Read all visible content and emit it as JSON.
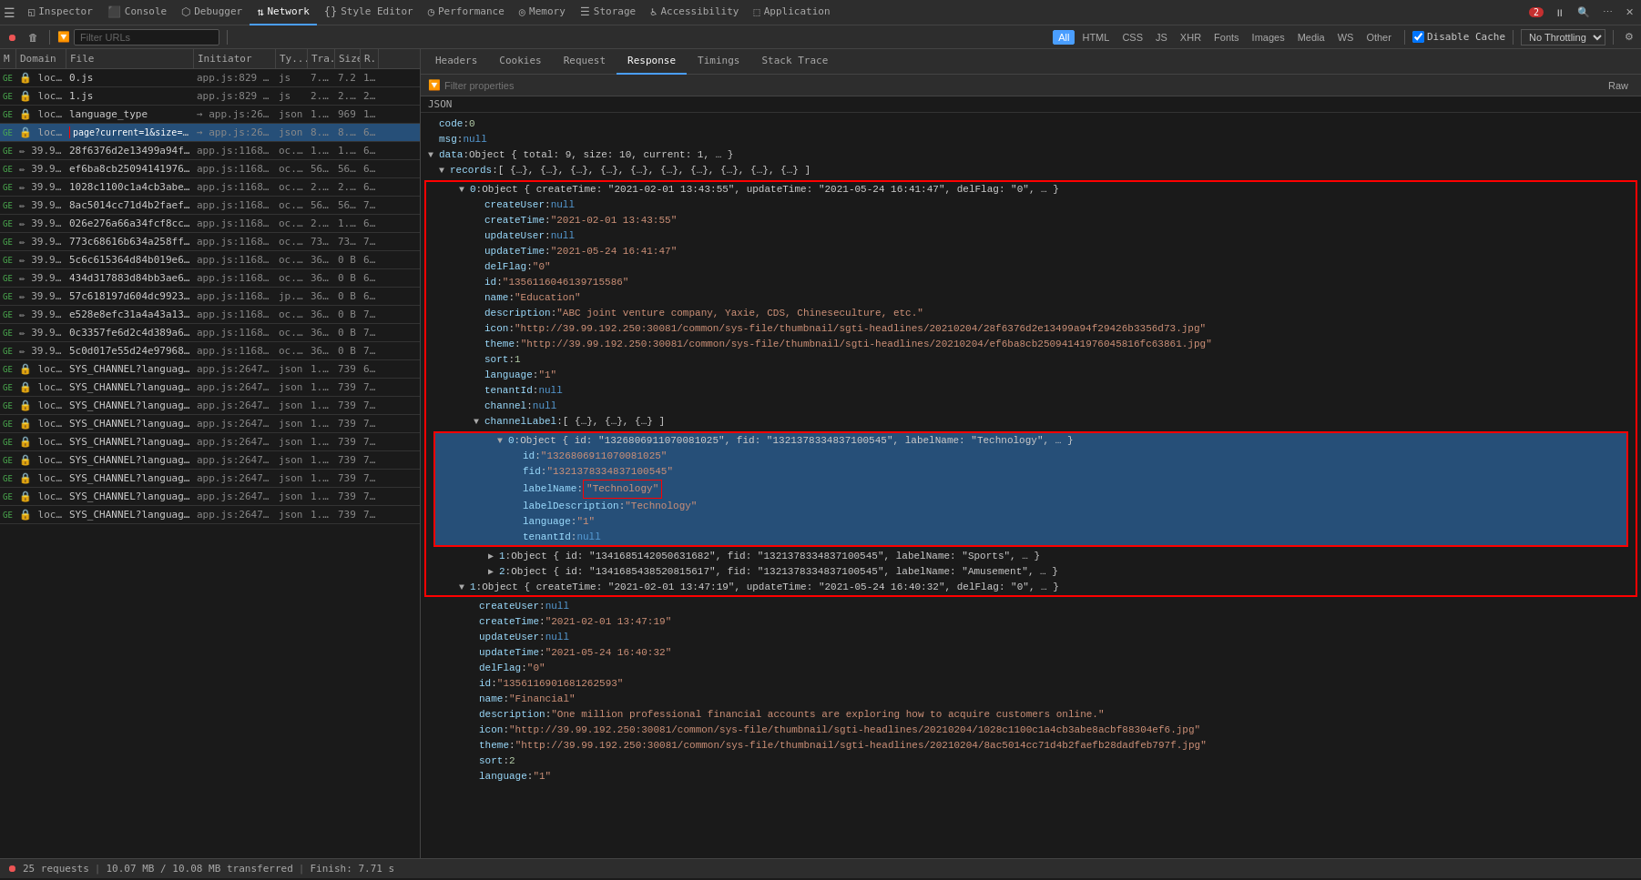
{
  "devtools": {
    "tabs": [
      {
        "label": "Inspector",
        "icon": "◱",
        "active": false
      },
      {
        "label": "Console",
        "icon": "⬛",
        "active": false
      },
      {
        "label": "Debugger",
        "icon": "⬡",
        "active": false
      },
      {
        "label": "Network",
        "icon": "⇅",
        "active": true
      },
      {
        "label": "Style Editor",
        "icon": "{}",
        "active": false
      },
      {
        "label": "Performance",
        "icon": "◷",
        "active": false
      },
      {
        "label": "Memory",
        "icon": "◎",
        "active": false
      },
      {
        "label": "Storage",
        "icon": "☰",
        "active": false
      },
      {
        "label": "Accessibility",
        "icon": "♿",
        "active": false
      },
      {
        "label": "Application",
        "icon": "⬚",
        "active": false
      }
    ],
    "error_count": "2",
    "toolbar_right_icons": [
      "pause",
      "search",
      "stop"
    ]
  },
  "network": {
    "filter_placeholder": "Filter URLs",
    "controls": {
      "pause_label": "⏸",
      "clear_label": "🗑",
      "search_label": "🔍",
      "camera_label": "📷"
    },
    "filter_types": [
      "All",
      "HTML",
      "CSS",
      "JS",
      "XHR",
      "Fonts",
      "Images",
      "Media",
      "WS",
      "Other"
    ],
    "active_filter": "All",
    "disable_cache": true,
    "disable_cache_label": "Disable Cache",
    "throttle_label": "No Throttling ▾",
    "gear_label": "⚙"
  },
  "columns": {
    "headers": [
      "M",
      "Domain",
      "File",
      "Initiator",
      "Ty...",
      "Tra...",
      "Size",
      "R..."
    ]
  },
  "requests": [
    {
      "method": "GE",
      "domain": "🔒 loca...",
      "file": "0.js",
      "initiator": "app.js:829 (…",
      "type": "js",
      "trans": "7.2...",
      "size": "7.2",
      "r": "1..."
    },
    {
      "method": "GE",
      "domain": "🔒 loca...",
      "file": "1.js",
      "initiator": "app.js:829 (…",
      "type": "js",
      "trans": "2.6...",
      "size": "2.6(",
      "r": "2..."
    },
    {
      "method": "GE",
      "domain": "🔒 loca...",
      "file": "language_type",
      "initiator": "→ app.js:2647...",
      "type": "json",
      "trans": "1.3...",
      "size": "969",
      "r": "1..."
    },
    {
      "method": "GE",
      "domain": "🔒 loca...",
      "file": "page?current=1&size=10",
      "initiator": "→ app.js:2647...",
      "type": "json",
      "trans": "8.9...",
      "size": "8.4(",
      "r": "6...",
      "selected": true,
      "red_outline": true
    },
    {
      "method": "GE",
      "domain": "✏ 39.9...",
      "file": "28f6376d2e13499a94f29426b3356d73.jpg",
      "initiator": "app.js:1168...",
      "type": "oc...",
      "trans": "1.7...",
      "size": "1.3(",
      "r": "6..."
    },
    {
      "method": "GE",
      "domain": "✏ 39.9...",
      "file": "ef6ba8cb25094141976045816fc63861.jpg",
      "initiator": "app.js:1168...",
      "type": "oc...",
      "trans": "56...",
      "size": "56.(",
      "r": "6..."
    },
    {
      "method": "GE",
      "domain": "✏ 39.9...",
      "file": "1028c1100c1a4cb3abe8acbf88304ef6.jpg",
      "initiator": "app.js:1168...",
      "type": "oc...",
      "trans": "2.7...",
      "size": "2.3(",
      "r": "6..."
    },
    {
      "method": "GE",
      "domain": "✏ 39.9...",
      "file": "8ac5014cc71d4b2faefb28dadfeb797f.jpg",
      "initiator": "app.js:1168...",
      "type": "oc...",
      "trans": "56...",
      "size": "56.(",
      "r": "7..."
    },
    {
      "method": "GE",
      "domain": "✏ 39.9...",
      "file": "026e276a66a34fcf8cc3c825e2dee606.jpg",
      "initiator": "app.js:1168...",
      "type": "oc...",
      "trans": "2.3...",
      "size": "1.8(",
      "r": "6..."
    },
    {
      "method": "GE",
      "domain": "✏ 39.9...",
      "file": "773c68616b634a258ffaaf4701aafb40.jpg",
      "initiator": "app.js:1168...",
      "type": "oc...",
      "trans": "73...",
      "size": "73.(",
      "r": "7..."
    },
    {
      "method": "GE",
      "domain": "✏ 39.9...",
      "file": "5c6c615364d84b019e6648c6cc7cd60a.jpg",
      "initiator": "app.js:1168...",
      "type": "oc...",
      "trans": "36...",
      "size": "0 B",
      "r": "6..."
    },
    {
      "method": "GE",
      "domain": "✏ 39.9...",
      "file": "434d317883d84bb3ae65ef3117104a50.jpg",
      "initiator": "app.js:1168...",
      "type": "oc...",
      "trans": "36...",
      "size": "0 B",
      "r": "6..."
    },
    {
      "method": "GE",
      "domain": "✏ 39.9...",
      "file": "57c618197d604dc99232ed3fd0d09237.jpg",
      "initiator": "app.js:1168...",
      "type": "jp...",
      "trans": "36...",
      "size": "0 B",
      "r": "6..."
    },
    {
      "method": "GE",
      "domain": "✏ 39.9...",
      "file": "e528e8efc31a4a43a13c53cac23e645e.jpg",
      "initiator": "app.js:1168...",
      "type": "oc...",
      "trans": "36...",
      "size": "0 B",
      "r": "7 s"
    },
    {
      "method": "GE",
      "domain": "✏ 39.9...",
      "file": "0c3357fe6d2c4d389a61a7ac36e72da4.jpg",
      "initiator": "app.js:1168...",
      "type": "oc...",
      "trans": "36...",
      "size": "0 B",
      "r": "7..."
    },
    {
      "method": "GE",
      "domain": "✏ 39.9...",
      "file": "5c0d017e55d24e97968a9437a651921a.jpg",
      "initiator": "app.js:1168...",
      "type": "oc...",
      "trans": "36...",
      "size": "0 B",
      "r": "7..."
    },
    {
      "method": "GE",
      "domain": "🔒 loca...",
      "file": "SYS_CHANNEL?language=",
      "initiator": "app.js:2647...",
      "type": "json",
      "trans": "1.1...",
      "size": "739",
      "r": "6..."
    },
    {
      "method": "GE",
      "domain": "🔒 loca...",
      "file": "SYS_CHANNEL?language=",
      "initiator": "app.js:2647...",
      "type": "json",
      "trans": "1.1...",
      "size": "739",
      "r": "7..."
    },
    {
      "method": "GE",
      "domain": "🔒 loca...",
      "file": "SYS_CHANNEL?language=",
      "initiator": "app.js:2647...",
      "type": "json",
      "trans": "1.1...",
      "size": "739",
      "r": "7..."
    },
    {
      "method": "GE",
      "domain": "🔒 loca...",
      "file": "SYS_CHANNEL?language=",
      "initiator": "app.js:2647...",
      "type": "json",
      "trans": "1.1...",
      "size": "739",
      "r": "7..."
    },
    {
      "method": "GE",
      "domain": "🔒 loca...",
      "file": "SYS_CHANNEL?language=",
      "initiator": "app.js:2647...",
      "type": "json",
      "trans": "1.1...",
      "size": "739",
      "r": "7..."
    },
    {
      "method": "GE",
      "domain": "🔒 loca...",
      "file": "SYS_CHANNEL?language=",
      "initiator": "app.js:2647...",
      "type": "json",
      "trans": "1.1...",
      "size": "739",
      "r": "7..."
    },
    {
      "method": "GE",
      "domain": "🔒 loca...",
      "file": "SYS_CHANNEL?language=",
      "initiator": "app.js:2647...",
      "type": "json",
      "trans": "1.1...",
      "size": "739",
      "r": "7..."
    },
    {
      "method": "GE",
      "domain": "🔒 loca...",
      "file": "SYS_CHANNEL?language=",
      "initiator": "app.js:2647...",
      "type": "json",
      "trans": "1.1...",
      "size": "739",
      "r": "7..."
    },
    {
      "method": "GE",
      "domain": "🔒 loca...",
      "file": "SYS_CHANNEL?language=",
      "initiator": "app.js:2647...",
      "type": "json",
      "trans": "1.1...",
      "size": "739",
      "r": "7..."
    }
  ],
  "detail_tabs": [
    {
      "label": "Headers",
      "active": false
    },
    {
      "label": "Cookies",
      "active": false
    },
    {
      "label": "Request",
      "active": false
    },
    {
      "label": "Response",
      "active": true
    },
    {
      "label": "Timings",
      "active": false
    },
    {
      "label": "Stack Trace",
      "active": false
    }
  ],
  "response": {
    "filter_placeholder": "Filter properties",
    "raw_label": "Raw",
    "json_label": "JSON",
    "lines": [
      {
        "indent": 0,
        "content": "code: 0",
        "type": "keyval",
        "key": "code",
        "val": "0",
        "val_type": "num"
      },
      {
        "indent": 0,
        "content": "msg: null",
        "type": "keyval",
        "key": "msg",
        "val": "null",
        "val_type": "null"
      },
      {
        "indent": 0,
        "content": "▼ data: Object { total: 9, size: 10, current: 1, … }",
        "type": "object_open",
        "key": "data",
        "summary": "Object { total: 9, size: 10, current: 1, … }",
        "expanded": true
      },
      {
        "indent": 1,
        "content": "▼ records: [ {…}, {…}, {…}, {…}, {…}, {…}, {…}, {…}, {…}, {…} ]",
        "type": "array_open",
        "key": "records",
        "summary": "[ {…}, {…}, {…}, {…}, {…}, {…}, {…}, {…}, {…}, {…} ]",
        "expanded": true
      },
      {
        "indent": 2,
        "content": "▼ 0: Object { createTime: \"2021-02-01 13:43:55\", updateTime: \"2021-05-24 16:41:47\", delFlag: \"0\", … }",
        "type": "object_open",
        "key": "0",
        "summary": "Object { createTime: \"2021-02-01 13:43:55\", updateTime: \"2021-05-24 16:41:47\", delFlag: \"0\", … }",
        "expanded": true,
        "red_box": true
      },
      {
        "indent": 3,
        "content": "createUser: null",
        "key": "createUser",
        "val": "null",
        "val_type": "null"
      },
      {
        "indent": 3,
        "content": "createTime: \"2021-02-01 13:43:55\"",
        "key": "createTime",
        "val": "\"2021-02-01 13:43:55\"",
        "val_type": "str"
      },
      {
        "indent": 3,
        "content": "updateUser: null",
        "key": "updateUser",
        "val": "null",
        "val_type": "null"
      },
      {
        "indent": 3,
        "content": "updateTime: \"2021-05-24 16:41:47\"",
        "key": "updateTime",
        "val": "\"2021-05-24 16:41:47\"",
        "val_type": "str"
      },
      {
        "indent": 3,
        "content": "delFlag: \"0\"",
        "key": "delFlag",
        "val": "\"0\"",
        "val_type": "str"
      },
      {
        "indent": 3,
        "content": "id: \"135611604613971558­6\"",
        "key": "id",
        "val": "\"135611604613971558­6\"",
        "val_type": "str"
      },
      {
        "indent": 3,
        "content": "name: \"Education\"",
        "key": "name",
        "val": "\"Education\"",
        "val_type": "str"
      },
      {
        "indent": 3,
        "content": "description: \"ABC joint venture company, Yaxie, CDS, Chineseculture, etc.\"",
        "key": "description",
        "val": "\"ABC joint venture company, Yaxie, CDS, Chineseculture, etc.\"",
        "val_type": "str"
      },
      {
        "indent": 3,
        "content": "icon: \"http://39.99.192.250:30081/common/sys-file/thumbnail/sgti-headlines/20210204/28f6376d2e13499a94f29426b3356d73.jpg\"",
        "key": "icon",
        "val": "\"http://39.99.192.250:30081/common/sys-file/thumbnail/sgti-headlines/20210204/28f6376d2e13499a94f29426b3356d73.jpg\"",
        "val_type": "str"
      },
      {
        "indent": 3,
        "content": "theme: \"http://39.99.192.250:30081/common/sys-file/thumbnail/sgti-headlines/20210204/ef6ba8cb25094141976045816fc63861.jpg\"",
        "key": "theme",
        "val": "\"http://39.99.192.250:30081/common/sys-file/thumbnail/sgti-headlines/20210204/ef6ba8cb25094141976045816fc63861.jpg\"",
        "val_type": "str"
      },
      {
        "indent": 3,
        "content": "sort: 1",
        "key": "sort",
        "val": "1",
        "val_type": "num"
      },
      {
        "indent": 3,
        "content": "language: \"1\"",
        "key": "language",
        "val": "\"1\"",
        "val_type": "str"
      },
      {
        "indent": 3,
        "content": "tenantId: null",
        "key": "tenantId",
        "val": "null",
        "val_type": "null"
      },
      {
        "indent": 3,
        "content": "channel: null",
        "key": "channel",
        "val": "null",
        "val_type": "null"
      },
      {
        "indent": 3,
        "content": "▼ channelLabel: [ {…}, {…}, {…} ]",
        "type": "array_open",
        "key": "channelLabel",
        "summary": "[ {…}, {…}, {…} ]",
        "expanded": true
      },
      {
        "indent": 4,
        "content": "▼ 0: Object { id: \"13268069110700810­25\", fid: \"13213783348371005­45\", labelName: \"Technology\", … }",
        "type": "object_open",
        "key": "0",
        "summary": "Object { id: \"13268069110700810­25\", fid: \"13213783348371005­45\", labelName: \"Technology\", … }",
        "expanded": true,
        "selected": true
      },
      {
        "indent": 5,
        "content": "id: \"1326806911070081025\"",
        "key": "id",
        "val": "\"1326806911070081025\"",
        "val_type": "str"
      },
      {
        "indent": 5,
        "content": "fid: \"1321378334837100545\"",
        "key": "fid",
        "val": "\"1321378334837100545\"",
        "val_type": "str"
      },
      {
        "indent": 5,
        "content": "labelName: \"Technology\"",
        "key": "labelName",
        "val": "\"Technology\"",
        "val_type": "str",
        "red_box_inline": true
      },
      {
        "indent": 5,
        "content": "labelDescription: \"Technology\"",
        "key": "labelDescription",
        "val": "\"Technology\"",
        "val_type": "str"
      },
      {
        "indent": 5,
        "content": "language: \"1\"",
        "key": "language",
        "val": "\"1\"",
        "val_type": "str"
      },
      {
        "indent": 5,
        "content": "tenantId: null",
        "key": "tenantId",
        "val": "null",
        "val_type": "null"
      },
      {
        "indent": 4,
        "content": "▶ 1: Object { id: \"1341685142050631682\", fid: \"1321378334837100545\", labelName: \"Sports\", … }",
        "type": "object_closed",
        "key": "1",
        "summary": "Object { id: \"1341685142050631682\", fid: \"1321378334837100545\", labelName: \"Sports\", … }"
      },
      {
        "indent": 4,
        "content": "▶ 2: Object { id: \"1341685438520815617\", fid: \"1321378334837100545\", labelName: \"Amusement\", … }",
        "type": "object_closed",
        "key": "2",
        "summary": "Object { id: \"1341685438520815617\", fid: \"1321378334837100545\", labelName: \"Amusement\", … }"
      },
      {
        "indent": 2,
        "content": "▼ 1: Object { createTime: \"2021-02-01 13:47:19\", updateTime: \"2021-05-24 16:40:32\", delFlag: \"0\", … }",
        "type": "object_open",
        "key": "1",
        "summary": "Object { createTime: \"2021-02-01 13:47:19\", updateTime: \"2021-05-24 16:40:32\", delFlag: \"0\", … }",
        "expanded": true
      },
      {
        "indent": 3,
        "content": "createUser: null",
        "key": "createUser",
        "val": "null",
        "val_type": "null"
      },
      {
        "indent": 3,
        "content": "createTime: \"2021-02-01 13:47:19\"",
        "key": "createTime",
        "val": "\"2021-02-01 13:47:19\"",
        "val_type": "str"
      },
      {
        "indent": 3,
        "content": "updateUser: null",
        "key": "updateUser",
        "val": "null",
        "val_type": "null"
      },
      {
        "indent": 3,
        "content": "updateTime: \"2021-05-24 16:40:32\"",
        "key": "updateTime",
        "val": "\"2021-05-24 16:40:32\"",
        "val_type": "str"
      },
      {
        "indent": 3,
        "content": "delFlag: \"0\"",
        "key": "delFlag",
        "val": "\"0\"",
        "val_type": "str"
      },
      {
        "indent": 3,
        "content": "id: \"1356116901681262593\"",
        "key": "id",
        "val": "\"1356116901681262593\"",
        "val_type": "str"
      },
      {
        "indent": 3,
        "content": "name: \"Financial\"",
        "key": "name",
        "val": "\"Financial\"",
        "val_type": "str"
      },
      {
        "indent": 3,
        "content": "description: \"One million professional financial accounts are exploring how to acquire customers online.\"",
        "key": "description",
        "val": "\"One million professional financial accounts are exploring how to acquire customers online.\"",
        "val_type": "str"
      },
      {
        "indent": 3,
        "content": "icon: \"http://39.99.192.250:30081/common/sys-file/thumbnail/sgti-headlines/20210204/1028c1100c1a4cb3abe8acbf88304ef6.jpg\"",
        "key": "icon",
        "val": "\"http://39.99.192.250:30081/common/sys-file/thumbnail/sgti-headlines/20210204/1028c1100c1a4cb3abe8acbf88304ef6.jpg\"",
        "val_type": "str"
      },
      {
        "indent": 3,
        "content": "theme: \"http://39.99.192.250:30081/common/sys-file/thumbnail/sgti-headlines/20210204/8ac5014cc71d4b2faefb28dadfeb797f.jpg\"",
        "key": "theme",
        "val": "\"http://39.99.192.250:30081/common/sys-file/thumbnail/sgti-headlines/20210204/8ac5014cc71d4b2faefb28dadfeb797f.jpg\"",
        "val_type": "str"
      },
      {
        "indent": 3,
        "content": "sort: 2",
        "key": "sort",
        "val": "2",
        "val_type": "num"
      },
      {
        "indent": 3,
        "content": "language: \"1\"",
        "key": "language",
        "val": "\"1\"",
        "val_type": "str"
      }
    ]
  },
  "status_bar": {
    "requests": "25 requests",
    "transferred": "10.07 MB / 10.08 MB transferred",
    "finish": "Finish: 7.71 s"
  }
}
